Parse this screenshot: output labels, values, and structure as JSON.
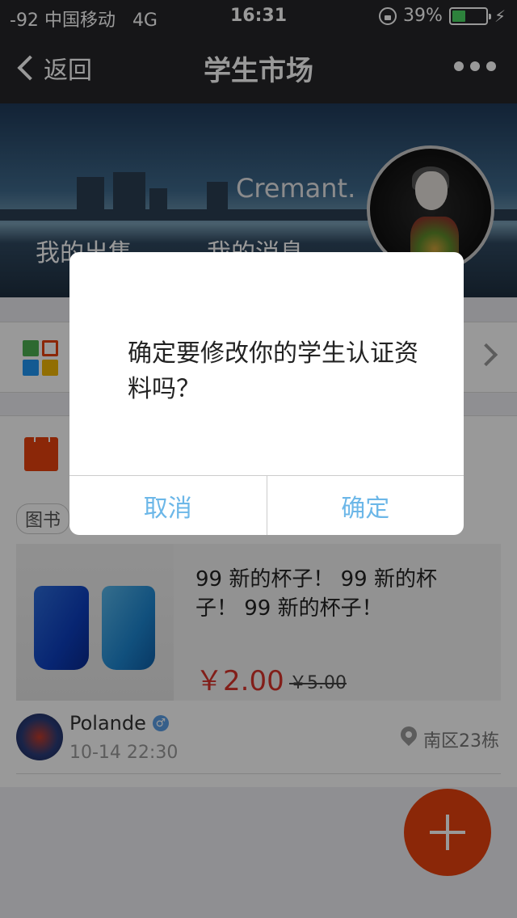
{
  "status_bar": {
    "signal": "-92",
    "carrier": "中国移动",
    "network": "4G",
    "time": "16:31",
    "battery_percent": "39%",
    "battery_level": 0.39,
    "icons": [
      "lock-rotation-icon",
      "battery-icon",
      "charging-bolt-icon"
    ]
  },
  "nav": {
    "back_label": "返回",
    "title": "学生市场",
    "more_icon": "more-dots-icon"
  },
  "banner": {
    "username": "Cremant.",
    "links": [
      "我的出售",
      "我的消息"
    ]
  },
  "listing": {
    "category_tag": "图书",
    "product_title": "99 新的杯子！ 99 新的杯子！ 99 新的杯子！",
    "price": "￥2.00",
    "original_price": "￥5.00",
    "seller_name": "Polande",
    "post_time": "10-14 22:30",
    "location": "南区23栋"
  },
  "dialog": {
    "message": "确定要修改你的学生认证资料吗？",
    "cancel_label": "取消",
    "confirm_label": "确定"
  },
  "colors": {
    "accent_orange": "#e8420e",
    "dialog_button_blue": "#6cb7e8",
    "price_red": "#d9332a"
  }
}
